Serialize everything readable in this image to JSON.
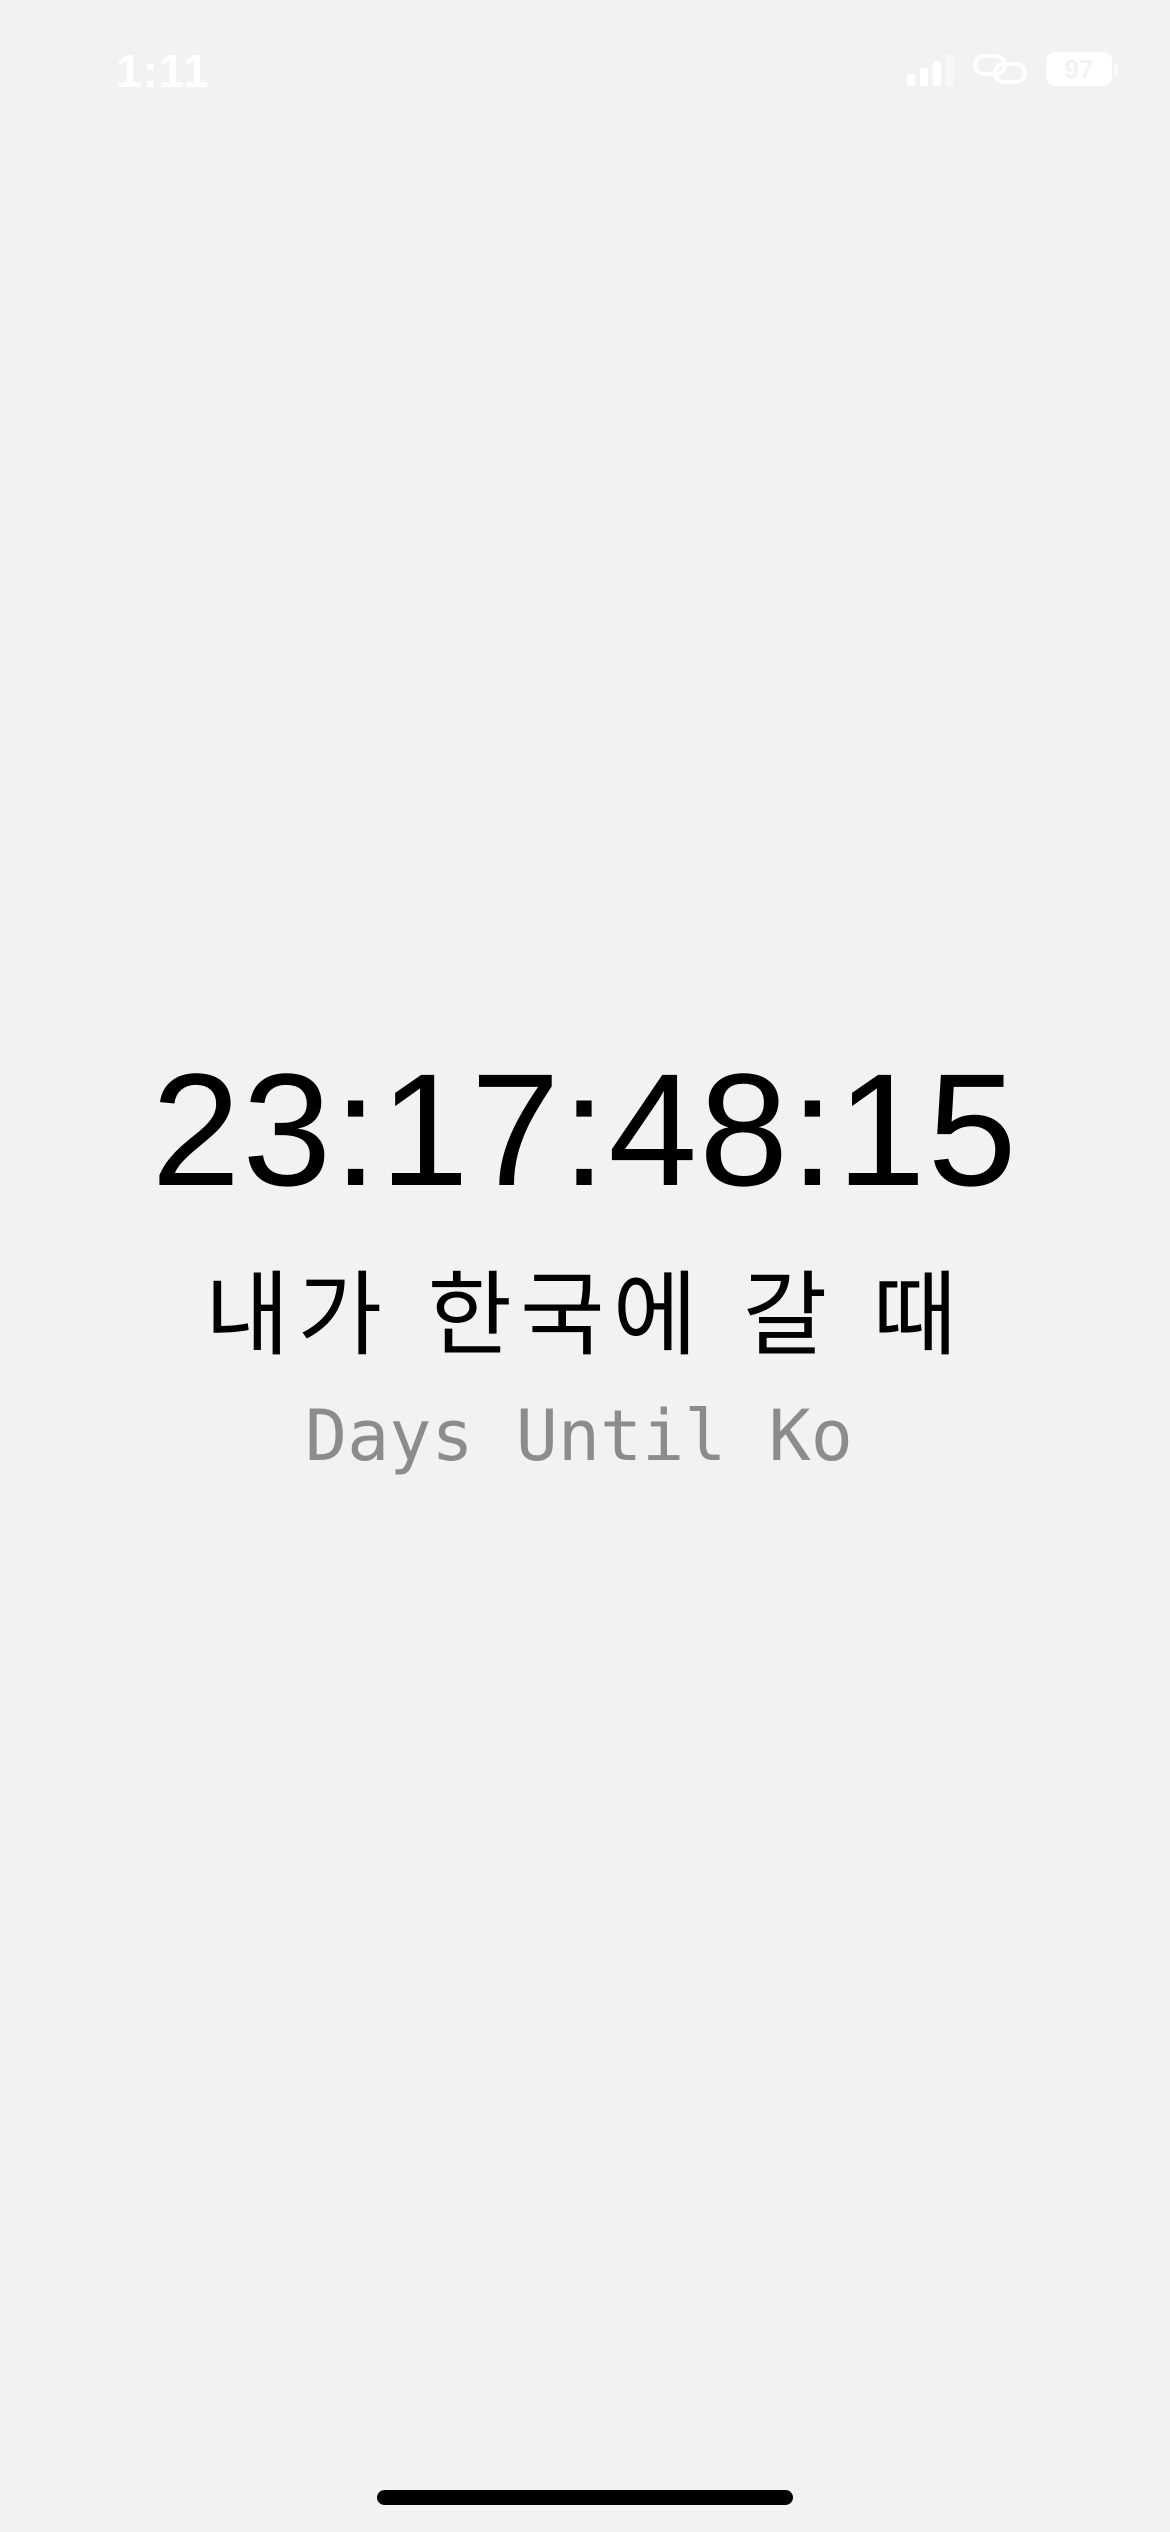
{
  "status_bar": {
    "time": "1:11",
    "battery_level": "97",
    "icons": [
      "signal-icon",
      "link-icon",
      "battery-icon"
    ]
  },
  "countdown": {
    "value": "23:17:48:15"
  },
  "title": {
    "korean": "내가 한국에 갈 때",
    "english": "Days Until Korea"
  },
  "colors": {
    "background": "#f2f2f2",
    "primary_text": "#000000",
    "secondary_text": "#8c8c8c",
    "status_text": "#ffffff"
  }
}
